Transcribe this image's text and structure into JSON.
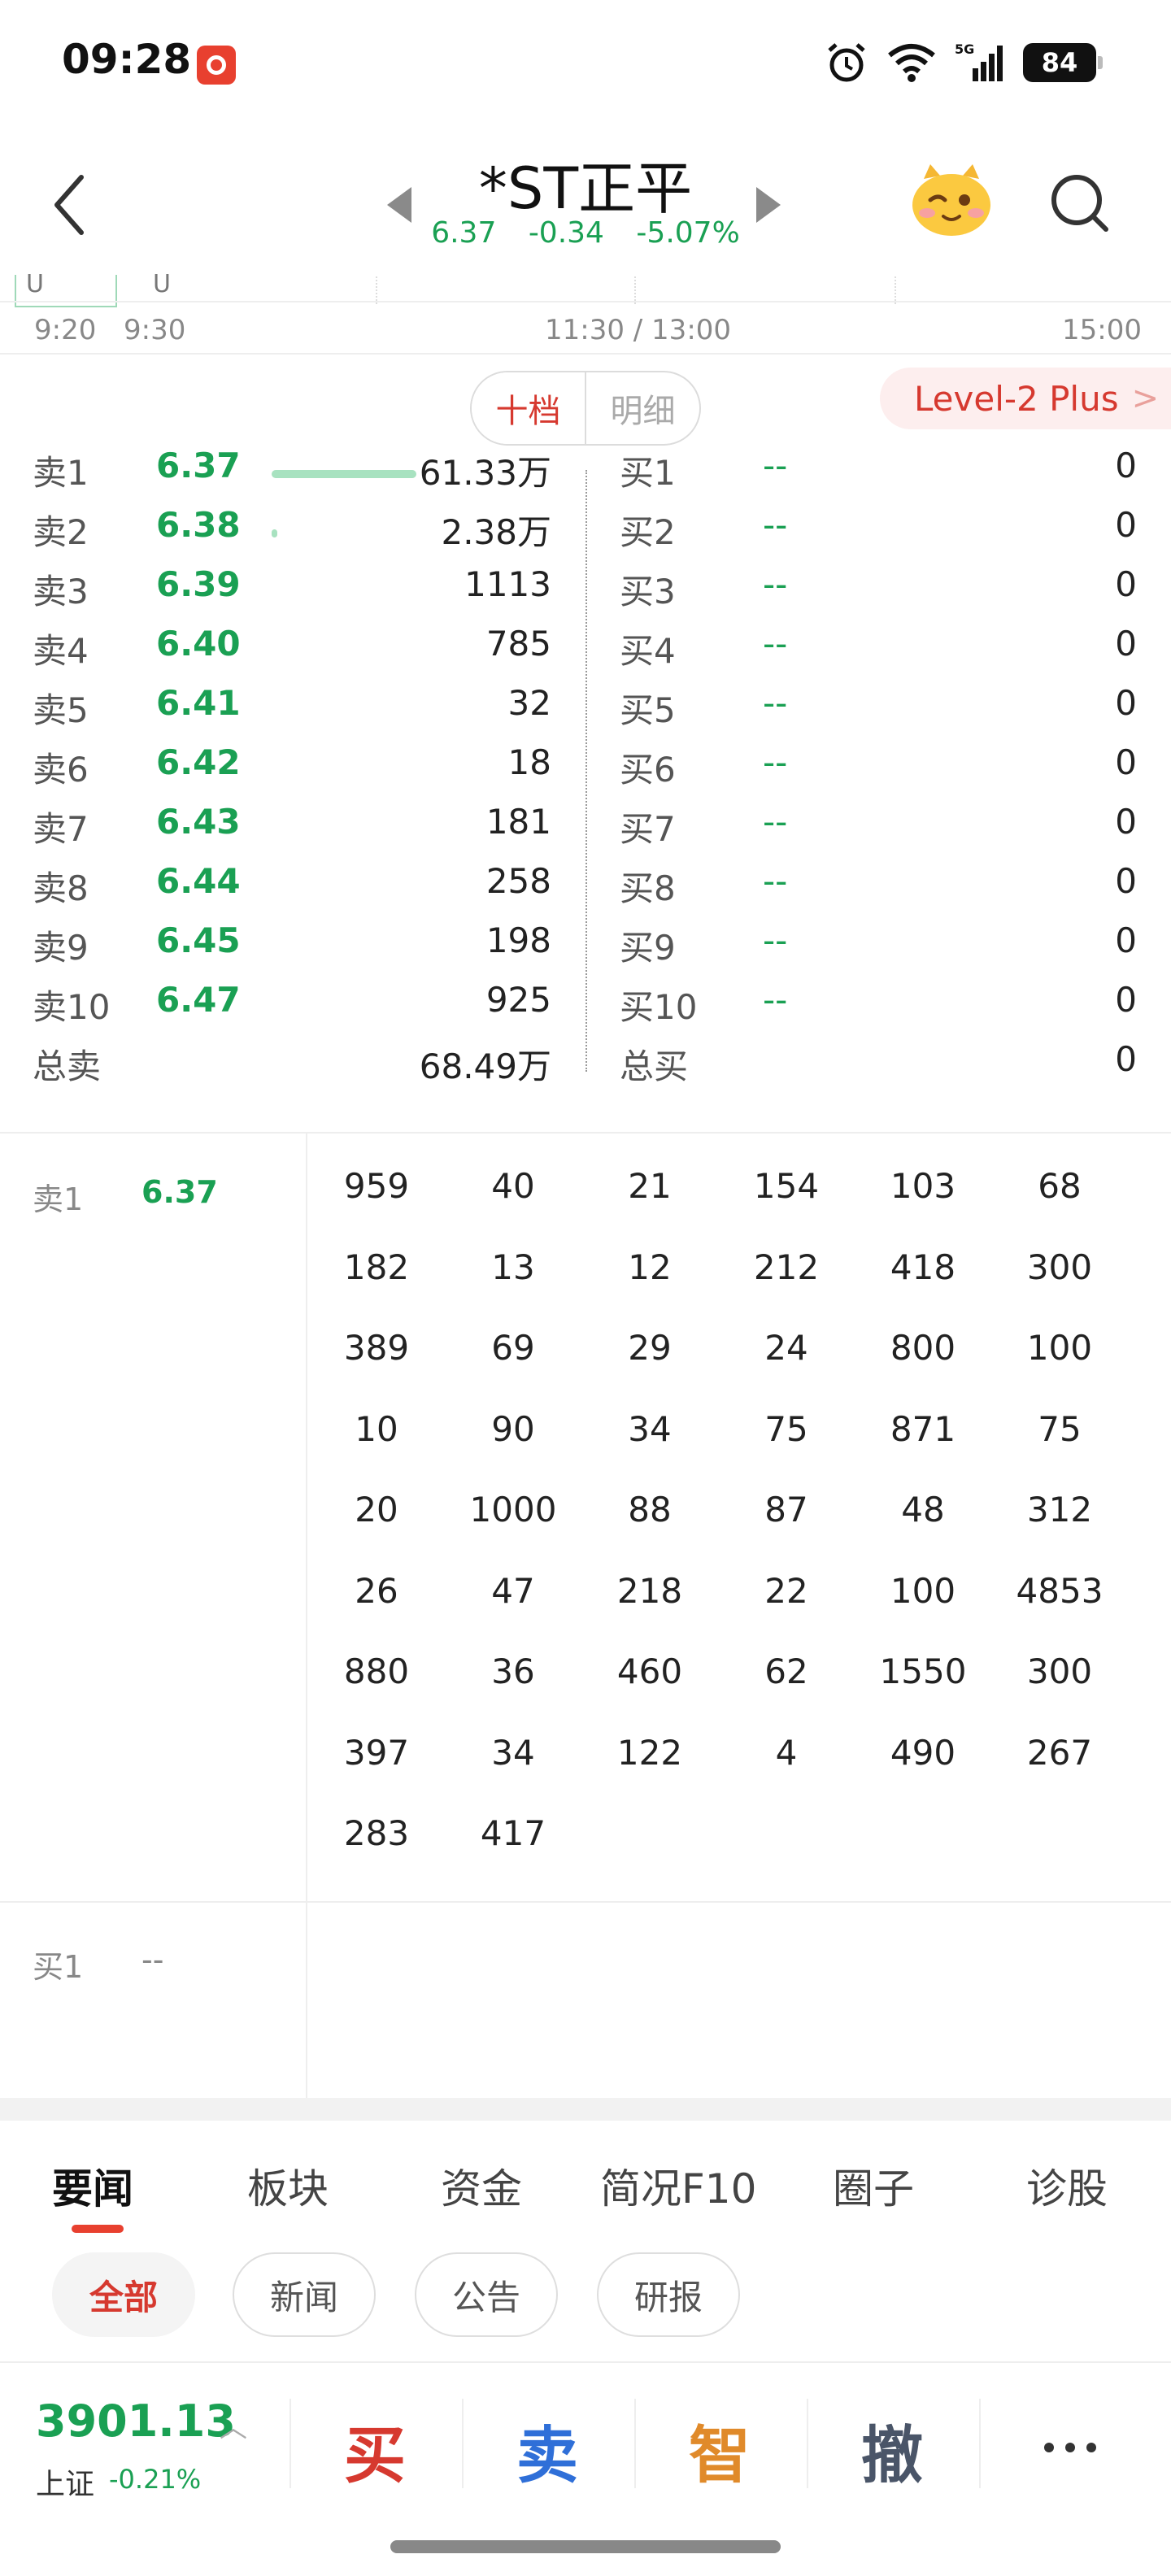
{
  "status_bar": {
    "time": "09:28",
    "battery": "84"
  },
  "header": {
    "title": "*ST正平",
    "price": "6.37",
    "change": "-0.34",
    "change_pct": "-5.07%"
  },
  "timeline": {
    "labels": [
      "9:20",
      "9:30",
      "11:30 / 13:00",
      "15:00"
    ],
    "marks": [
      "U",
      "U"
    ]
  },
  "order_tabs": {
    "ten": "十档",
    "detail": "明细"
  },
  "level2": {
    "label": "Level-2 Plus",
    "chevron": ">"
  },
  "asks": [
    {
      "label": "卖1",
      "price": "6.37",
      "volume": "61.33万",
      "bar": 1.0
    },
    {
      "label": "卖2",
      "price": "6.38",
      "volume": "2.38万",
      "bar": 0.04
    },
    {
      "label": "卖3",
      "price": "6.39",
      "volume": "1113",
      "bar": 0.0
    },
    {
      "label": "卖4",
      "price": "6.40",
      "volume": "785",
      "bar": 0.0
    },
    {
      "label": "卖5",
      "price": "6.41",
      "volume": "32",
      "bar": 0.0
    },
    {
      "label": "卖6",
      "price": "6.42",
      "volume": "18",
      "bar": 0.0
    },
    {
      "label": "卖7",
      "price": "6.43",
      "volume": "181",
      "bar": 0.0
    },
    {
      "label": "卖8",
      "price": "6.44",
      "volume": "258",
      "bar": 0.0
    },
    {
      "label": "卖9",
      "price": "6.45",
      "volume": "198",
      "bar": 0.0
    },
    {
      "label": "卖10",
      "price": "6.47",
      "volume": "925",
      "bar": 0.0
    }
  ],
  "bids": [
    {
      "label": "买1",
      "price": "--",
      "volume": "0"
    },
    {
      "label": "买2",
      "price": "--",
      "volume": "0"
    },
    {
      "label": "买3",
      "price": "--",
      "volume": "0"
    },
    {
      "label": "买4",
      "price": "--",
      "volume": "0"
    },
    {
      "label": "买5",
      "price": "--",
      "volume": "0"
    },
    {
      "label": "买6",
      "price": "--",
      "volume": "0"
    },
    {
      "label": "买7",
      "price": "--",
      "volume": "0"
    },
    {
      "label": "买8",
      "price": "--",
      "volume": "0"
    },
    {
      "label": "买9",
      "price": "--",
      "volume": "0"
    },
    {
      "label": "买10",
      "price": "--",
      "volume": "0"
    }
  ],
  "totals": {
    "ask_label": "总卖",
    "ask_total": "68.49万",
    "bid_label": "总买",
    "bid_total": "0"
  },
  "queue": {
    "ask_label": "卖1",
    "ask_price": "6.37",
    "orders": [
      "959",
      "40",
      "21",
      "154",
      "103",
      "68",
      "182",
      "13",
      "12",
      "212",
      "418",
      "300",
      "389",
      "69",
      "29",
      "24",
      "800",
      "100",
      "10",
      "90",
      "34",
      "75",
      "871",
      "75",
      "20",
      "1000",
      "88",
      "87",
      "48",
      "312",
      "26",
      "47",
      "218",
      "22",
      "100",
      "4853",
      "880",
      "36",
      "460",
      "62",
      "1550",
      "300",
      "397",
      "34",
      "122",
      "4",
      "490",
      "267",
      "283",
      "417"
    ],
    "bid_label": "买1",
    "bid_price": "--"
  },
  "news_tabs": [
    "要闻",
    "板块",
    "资金",
    "简况F10",
    "圈子",
    "诊股"
  ],
  "news_chips": [
    "全部",
    "新闻",
    "公告",
    "研报"
  ],
  "bottom_bar": {
    "index_value": "3901.13",
    "index_name": "上证",
    "index_change": "-0.21%",
    "actions": [
      "买",
      "卖",
      "智",
      "撤"
    ]
  },
  "colors": {
    "green": "#1aa053",
    "red": "#d6392f",
    "blue": "#2f6fd8",
    "orange": "#e08a2a",
    "gray": "#4a5568"
  },
  "icons": [
    "alarm-icon",
    "wifi-icon",
    "signal-icon",
    "back-icon",
    "search-icon",
    "mascot-icon",
    "more-icon"
  ]
}
